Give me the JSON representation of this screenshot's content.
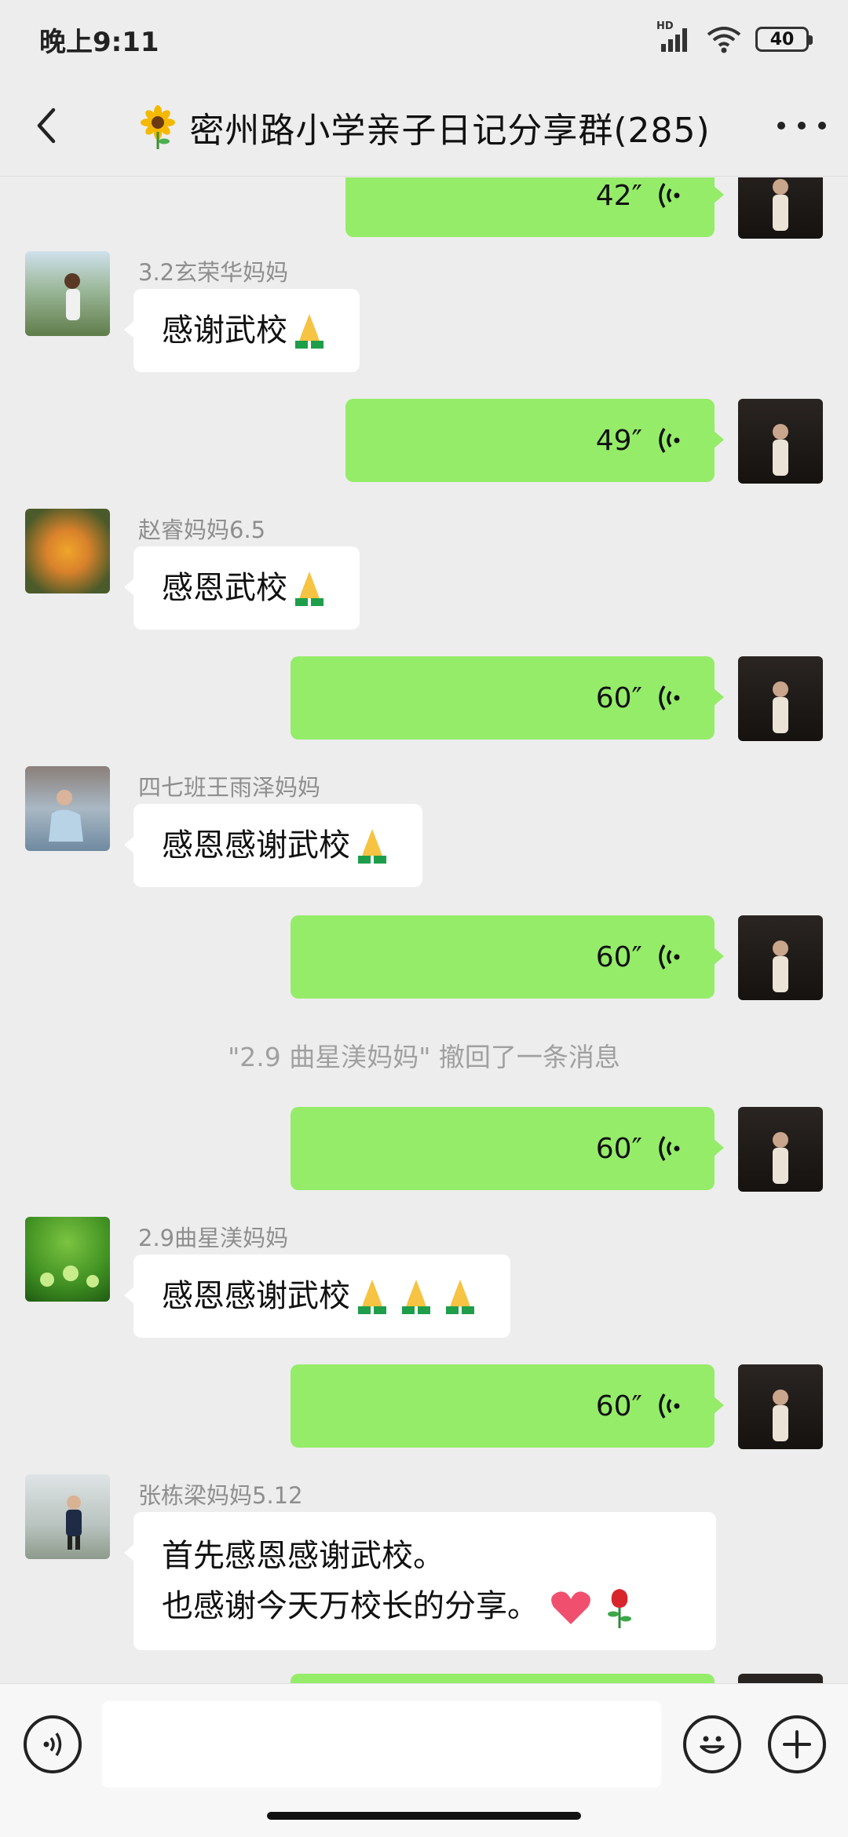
{
  "status": {
    "time": "晚上9:11",
    "network": "HD",
    "battery": "40"
  },
  "header": {
    "emoji": "🌻",
    "title": "密州路小学亲子日记分享群(285)"
  },
  "messages": {
    "m0_duration": "42″",
    "m1_sender": "3.2玄荣华妈妈",
    "m1_text": "感谢武校",
    "m2_duration": "49″",
    "m3_sender": "赵睿妈妈6.5",
    "m3_text": "感恩武校",
    "m4_duration": "60″",
    "m5_sender": "四七班王雨泽妈妈",
    "m5_text": "感恩感谢武校",
    "m6_duration": "60″",
    "system_notice": "\"2.9 曲星渼妈妈\" 撤回了一条消息",
    "m7_duration": "60″",
    "m8_sender": "2.9曲星渼妈妈",
    "m8_text": "感恩感谢武校",
    "m9_duration": "60″",
    "m10_sender": "张栋梁妈妈5.12",
    "m10_line1": "首先感恩感谢武校。",
    "m10_line2": "也感谢今天万校长的分享。"
  },
  "colors": {
    "outgoing_bubble": "#95ec69",
    "incoming_bubble": "#ffffff",
    "background": "#ededed"
  },
  "icons": [
    "back-arrow-icon",
    "more-icon",
    "voice-wave-icon",
    "folded-hands-emoji",
    "heart-emoji",
    "rose-emoji",
    "voice-input-icon",
    "emoji-icon",
    "plus-icon"
  ]
}
